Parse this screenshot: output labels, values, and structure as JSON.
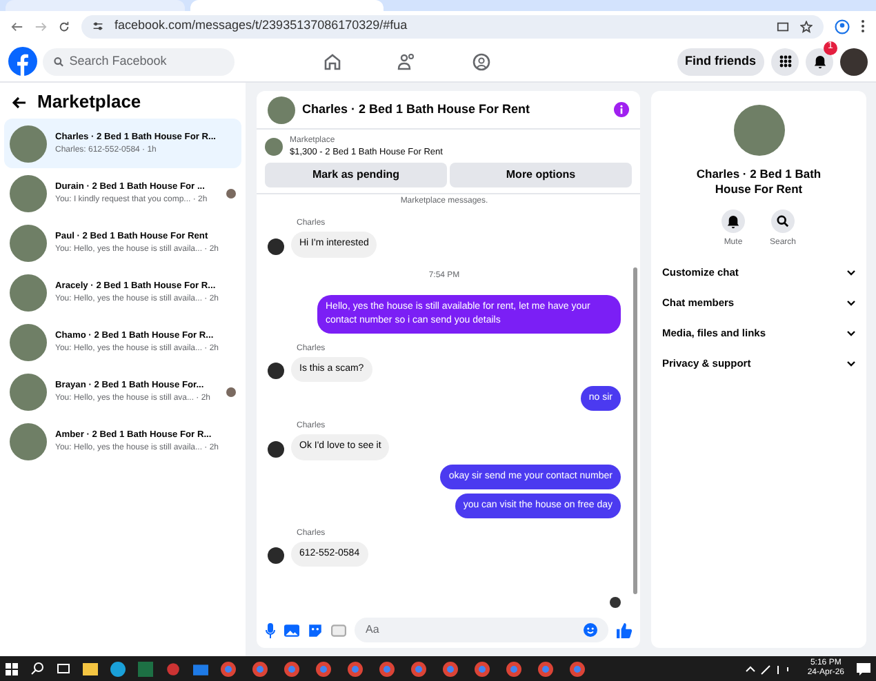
{
  "browser": {
    "url": "facebook.com/messages/t/23935137086170329/#fua",
    "tabs": [
      {
        "selected": false
      },
      {
        "selected": true
      }
    ]
  },
  "header": {
    "search_placeholder": "Search Facebook",
    "nav": [
      {
        "kind": "home",
        "selected": false
      },
      {
        "kind": "friends",
        "selected": false
      },
      {
        "kind": "groups",
        "selected": false
      }
    ],
    "find_friends": "Find friends",
    "notification_count": "1"
  },
  "sidebar": {
    "title": "Marketplace",
    "items": [
      {
        "title": "Charles · 2 Bed 1 Bath House For R...",
        "preview": "Charles: 612-552-0584 · 1h",
        "selected": true,
        "seen_avatar": false
      },
      {
        "title": "Durain · 2 Bed 1 Bath House For ...",
        "preview": "You: I kindly request that you comp... · 2h",
        "selected": false,
        "seen_avatar": true
      },
      {
        "title": "Paul · 2 Bed 1 Bath House For Rent",
        "preview": "You: Hello, yes the house is still availa... · 2h",
        "selected": false,
        "seen_avatar": false
      },
      {
        "title": "Aracely · 2 Bed 1 Bath House For R...",
        "preview": "You: Hello, yes the house is still availa... · 2h",
        "selected": false,
        "seen_avatar": false
      },
      {
        "title": "Chamo · 2 Bed 1 Bath House For R...",
        "preview": "You: Hello, yes the house is still availa... · 2h",
        "selected": false,
        "seen_avatar": false
      },
      {
        "title": "Brayan · 2 Bed 1 Bath House For...",
        "preview": "You: Hello, yes the house is still ava... · 2h",
        "selected": false,
        "seen_avatar": true
      },
      {
        "title": "Amber · 2 Bed 1 Bath House For R...",
        "preview": "You: Hello, yes the house is still availa... · 2h",
        "selected": false,
        "seen_avatar": false
      }
    ]
  },
  "chat": {
    "title": "Charles · 2 Bed 1 Bath House For Rent",
    "listing": {
      "label": "Marketplace",
      "title": "$1,300 - 2 Bed 1 Bath House For Rent"
    },
    "buttons": [
      "Mark as pending",
      "More options"
    ],
    "notice": "Marketplace messages.",
    "messages": [
      {
        "kind": "incoming",
        "sender": "Charles",
        "text": "Hi I'm interested"
      },
      {
        "kind": "time",
        "text": "7:54 PM"
      },
      {
        "kind": "outgoing",
        "text": "Hello, yes the house is still available for rent, let me have your contact number so i can send you  details"
      },
      {
        "kind": "incoming",
        "sender": "Charles",
        "text": "Is this a scam?"
      },
      {
        "kind": "outgoing",
        "text": "no sir"
      },
      {
        "kind": "incoming",
        "sender": "Charles",
        "text": "Ok I'd love to see it"
      },
      {
        "kind": "outgoing",
        "text": "okay sir send me your contact number"
      },
      {
        "kind": "outgoing",
        "text": "you can visit the house on free day"
      },
      {
        "kind": "incoming",
        "sender": "Charles",
        "text": "612-552-0584"
      }
    ],
    "composer_placeholder": "Aa"
  },
  "details": {
    "title": "Charles · 2 Bed 1 Bath House For Rent",
    "actions": [
      {
        "kind": "mute",
        "label": "Mute"
      },
      {
        "kind": "search",
        "label": "Search"
      }
    ],
    "sections": [
      {
        "label": "Customize chat",
        "expanded": false
      },
      {
        "label": "Chat members",
        "expanded": false
      },
      {
        "label": "Media, files and links",
        "expanded": false
      },
      {
        "label": "Privacy & support",
        "expanded": false
      }
    ]
  },
  "taskbar": {
    "time": "5:16 PM",
    "date": "24-Apr-26"
  }
}
